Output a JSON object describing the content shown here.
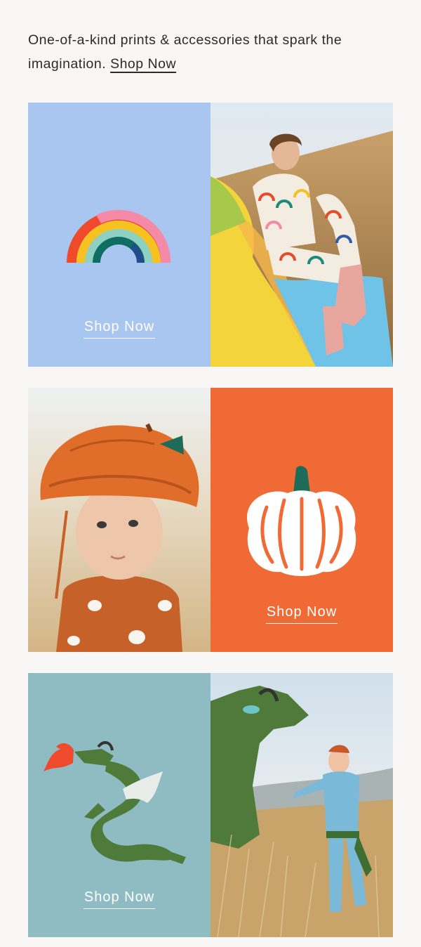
{
  "intro": {
    "text": "One-of-a-kind prints & accessories that spark the imagination.",
    "link": "Shop Now"
  },
  "blocks": [
    {
      "name": "rainbow",
      "graphic": "rainbow-icon",
      "photo": "girl-in-rainbow-pajamas-photo",
      "cta": "Shop Now",
      "colors": {
        "panel": "#a8c6f0"
      }
    },
    {
      "name": "pumpkin",
      "graphic": "pumpkin-icon",
      "photo": "baby-in-pumpkin-hat-photo",
      "cta": "Shop Now",
      "colors": {
        "panel": "#f06a35"
      }
    },
    {
      "name": "dragon",
      "graphic": "dragon-icon",
      "photo": "boy-with-dragon-photo",
      "cta": "Shop Now",
      "colors": {
        "panel": "#8fbcc2"
      }
    }
  ]
}
